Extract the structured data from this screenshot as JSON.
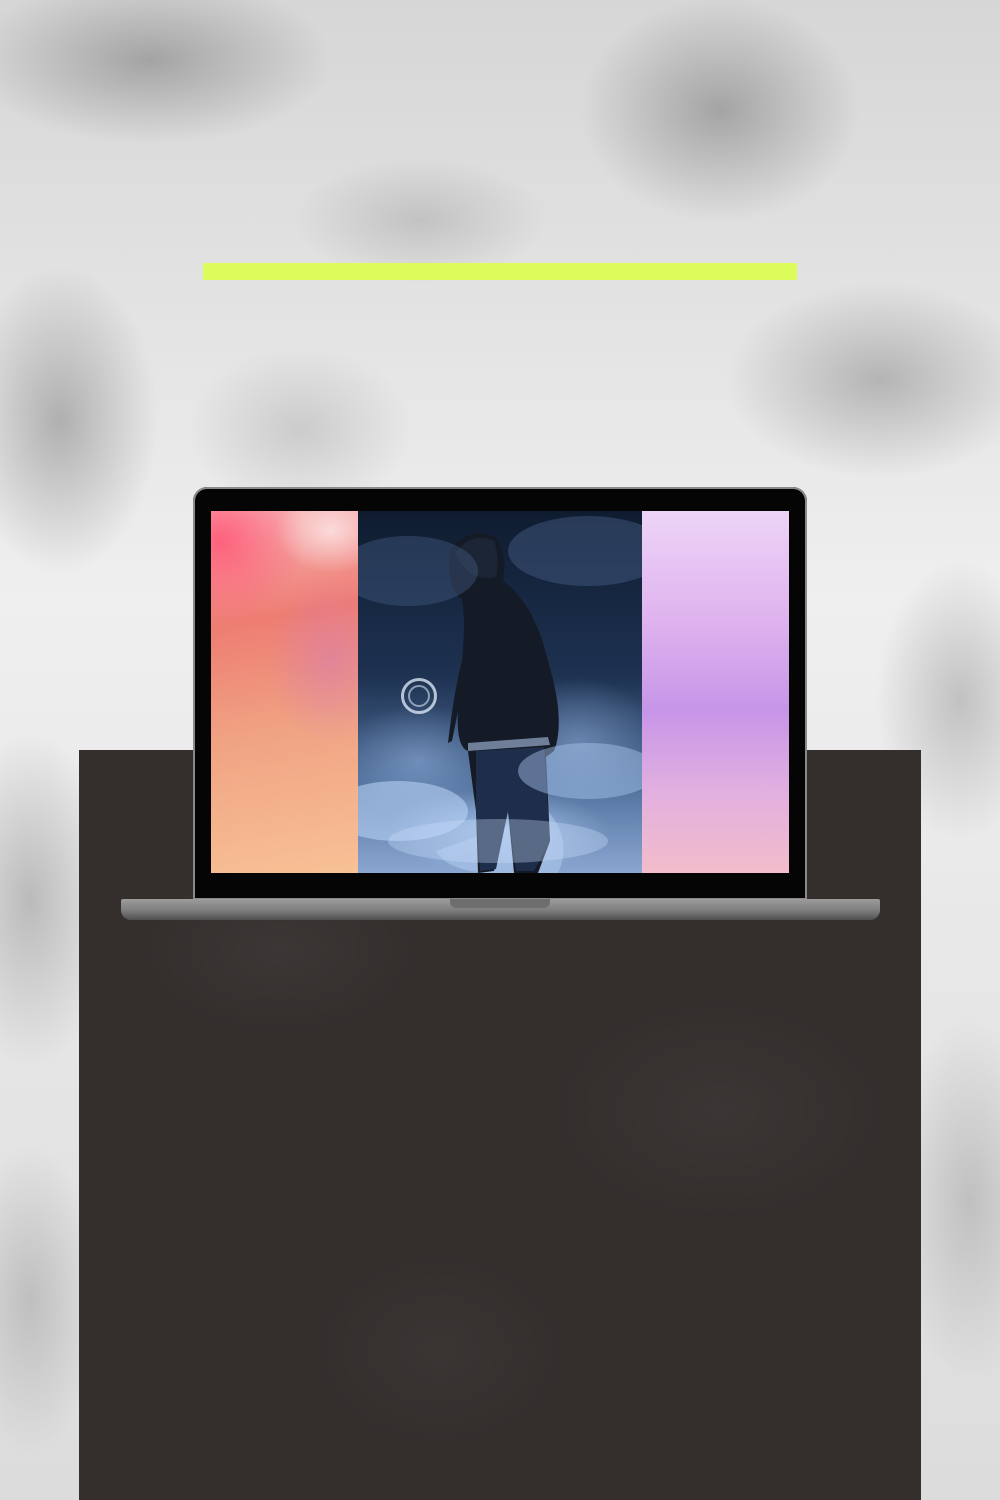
{
  "colors": {
    "accent_bar": "#dcfc5c",
    "panel": "#342e2d",
    "laptop_frame": "#050505",
    "laptop_base": "#8a8a8a"
  },
  "screen": {
    "left_panel": "gradient-pink-orange",
    "center_image": "hooded-figure-in-smoke",
    "center_icon": "ring-icon",
    "right_panel": "gradient-lavender-pink"
  }
}
